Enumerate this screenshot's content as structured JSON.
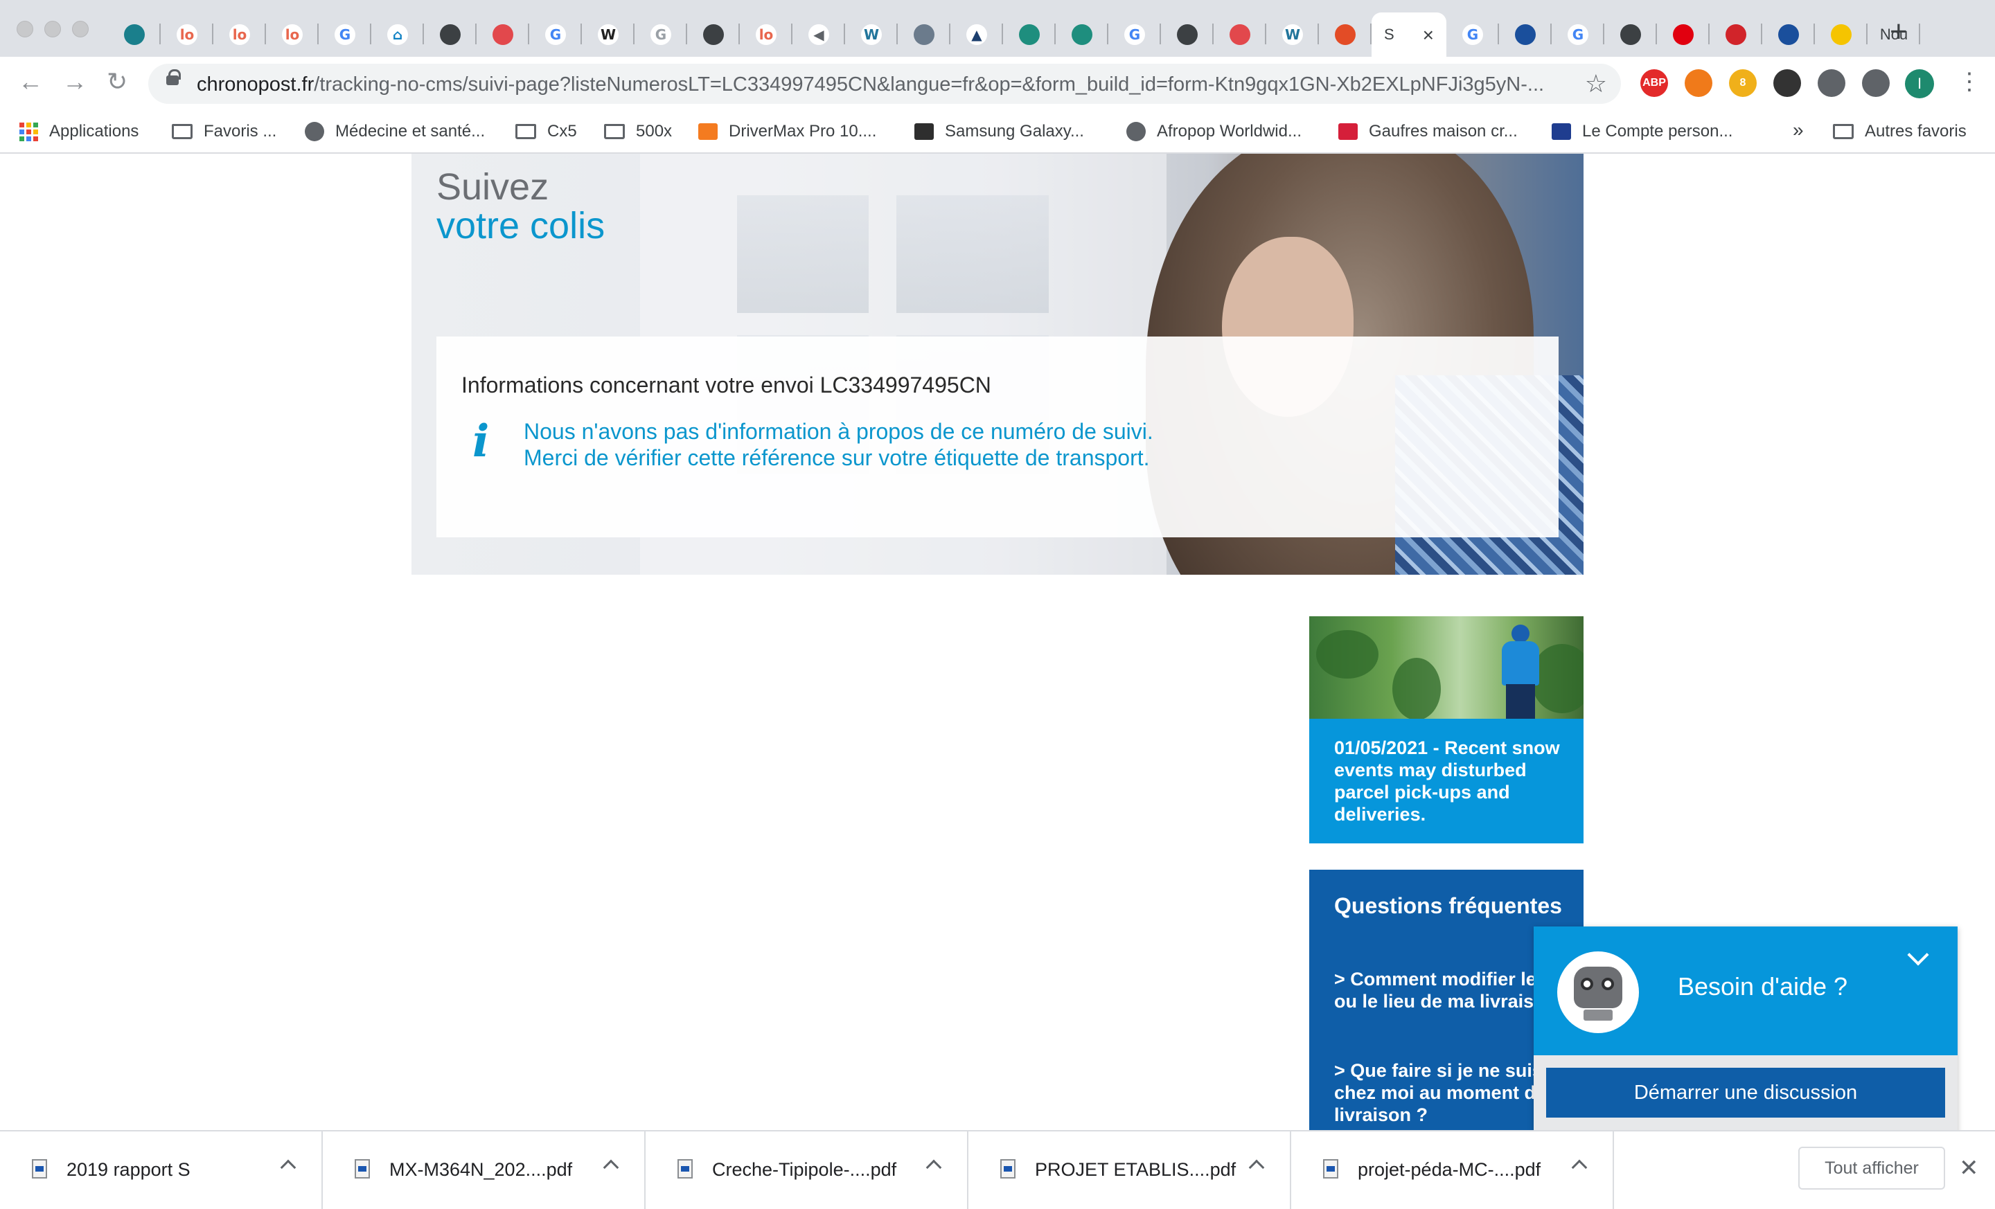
{
  "tabs": {
    "items": [
      {
        "icon": "swoosh-icon",
        "letter": "",
        "color": "#1a7f8c"
      },
      {
        "icon": "lo-icon",
        "letter": "lo",
        "color": "#e8674e"
      },
      {
        "icon": "lo-icon",
        "letter": "lo",
        "color": "#e8674e"
      },
      {
        "icon": "lo-icon",
        "letter": "lo",
        "color": "#e8674e"
      },
      {
        "icon": "google-icon",
        "letter": "G",
        "color": "#4285f4"
      },
      {
        "icon": "home-icon",
        "letter": "⌂",
        "color": "#0b7fc2"
      },
      {
        "icon": "globe-icon",
        "letter": "",
        "color": "#3c4043"
      },
      {
        "icon": "red-circle-icon",
        "letter": "",
        "color": "#e2484c"
      },
      {
        "icon": "google-icon",
        "letter": "G",
        "color": "#4285f4"
      },
      {
        "icon": "wikipedia-icon",
        "letter": "W",
        "color": "#222"
      },
      {
        "icon": "google-icon",
        "letter": "G",
        "color": "#9aa0a6"
      },
      {
        "icon": "globe-icon",
        "letter": "",
        "color": "#3c4043"
      },
      {
        "icon": "lo-icon",
        "letter": "lo",
        "color": "#e8674e"
      },
      {
        "icon": "audio-icon",
        "letter": "◀",
        "color": "#5f6368"
      },
      {
        "icon": "wordpress-icon",
        "letter": "W",
        "color": "#21759b"
      },
      {
        "icon": "image-icon",
        "letter": "",
        "color": "#6b7b8c"
      },
      {
        "icon": "mountain-icon",
        "letter": "▲",
        "color": "#1c3f6e"
      },
      {
        "icon": "teal-circle-icon",
        "letter": "",
        "color": "#1e8e7e"
      },
      {
        "icon": "teal-circle-icon",
        "letter": "",
        "color": "#1e8e7e"
      },
      {
        "icon": "google-icon",
        "letter": "G",
        "color": "#4285f4"
      },
      {
        "icon": "globe-icon",
        "letter": "",
        "color": "#3c4043"
      },
      {
        "icon": "red-circle-icon",
        "letter": "",
        "color": "#e2484c"
      },
      {
        "icon": "wordpress-icon",
        "letter": "W",
        "color": "#21759b"
      },
      {
        "icon": "red-square-icon",
        "letter": "",
        "color": "#e34c26"
      }
    ],
    "active": {
      "icon": "chronopost-icon",
      "text": "S"
    },
    "after": [
      {
        "icon": "google-icon",
        "letter": "G",
        "color": "#4285f4"
      },
      {
        "icon": "ball-icon",
        "letter": "",
        "color": "#1a4f9c"
      },
      {
        "icon": "google-icon",
        "letter": "G",
        "color": "#4285f4"
      },
      {
        "icon": "globe-icon",
        "letter": "",
        "color": "#3c4043"
      },
      {
        "icon": "flag-icon",
        "letter": "",
        "color": "#e1000f"
      },
      {
        "icon": "tele-icon",
        "letter": "",
        "color": "#d1242a"
      },
      {
        "icon": "ball-icon",
        "letter": "",
        "color": "#1a4f9c"
      },
      {
        "icon": "laposte-icon",
        "letter": "",
        "color": "#f5c400"
      }
    ],
    "last_tab_text": "Nou"
  },
  "toolbar": {
    "url_host": "chronopost.fr",
    "url_path": "/tracking-no-cms/suivi-page?listeNumerosLT=LC334997495CN&langue=fr&op=&form_build_id=form-Ktn9gqx1GN-Xb2EXLpNFJi3g5yN-...",
    "extensions": [
      {
        "icon": "adblock-icon",
        "label": "ABP",
        "color": "#e32a2a"
      },
      {
        "icon": "fire-icon",
        "label": "",
        "color": "#f07a1a"
      },
      {
        "icon": "badge-icon",
        "label": "8",
        "color": "#f0b01a"
      },
      {
        "icon": "pen-icon",
        "label": "",
        "color": "#333"
      },
      {
        "icon": "puzzle-icon",
        "label": "",
        "color": "#5f6368"
      },
      {
        "icon": "playlist-icon",
        "label": "",
        "color": "#5f6368"
      }
    ],
    "profile_initial": "I"
  },
  "bookmarks": {
    "items": [
      {
        "label": "Applications",
        "icon": "apps-grid-icon"
      },
      {
        "label": "Favoris ...",
        "icon": "folder-icon"
      },
      {
        "label": "Médecine et santé...",
        "icon": "globe-icon"
      },
      {
        "label": "Cx5",
        "icon": "folder-icon"
      },
      {
        "label": "500x",
        "icon": "folder-icon"
      },
      {
        "label": "DriverMax Pro 10....",
        "icon": "orange-square-icon"
      },
      {
        "label": "Samsung Galaxy...",
        "icon": "e-icon"
      },
      {
        "label": "Afropop Worldwid...",
        "icon": "globe-icon"
      },
      {
        "label": "Gaufres maison cr...",
        "icon": "red-square-icon"
      },
      {
        "label": "Le Compte person...",
        "icon": "fr-flag-icon"
      }
    ],
    "more": "»",
    "other": "Autres favoris"
  },
  "hero": {
    "title_line1": "Suivez",
    "title_line2": "votre colis",
    "info_heading": "Informations concernant votre envoi LC334997495CN",
    "info_icon": "i",
    "info_line1": "Nous n'avons pas d'information à propos de ce numéro de suivi.",
    "info_line2": "Merci de vérifier cette référence sur votre étiquette de transport."
  },
  "news": {
    "text": "01/05/2021 - Recent snow events may disturbed parcel pick-ups and deliveries."
  },
  "faq": {
    "title": "Questions fréquentes",
    "q1": "> Comment modifier le jour ou le lieu de ma livraison ?",
    "q2": "> Que faire si je ne suis pas chez moi au moment de la livraison ?"
  },
  "chat": {
    "title": "Besoin d'aide ?",
    "button": "Démarrer une discussion"
  },
  "downloads": {
    "items": [
      {
        "name": "2019 rapport S"
      },
      {
        "name": "MX-M364N_202....pdf"
      },
      {
        "name": "Creche-Tipipole-....pdf"
      },
      {
        "name": "PROJET ETABLIS....pdf"
      },
      {
        "name": "projet-péda-MC-....pdf"
      }
    ],
    "show_all": "Tout afficher",
    "close": "✕"
  },
  "colors": {
    "chronopost_blue": "#0696db",
    "chronopost_dark": "#0f5ea8",
    "accent_text": "#0b96cd"
  }
}
